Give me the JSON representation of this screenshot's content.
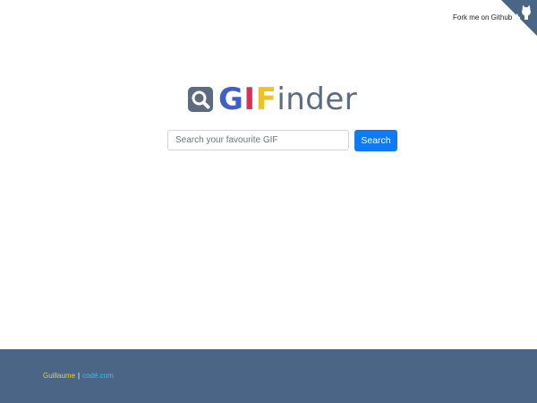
{
  "corner": {
    "fork_label": "Fork me on Github",
    "icon": "github-octocat-icon",
    "ribbon_color": "#4a6585"
  },
  "logo": {
    "icon": "magnifier-icon",
    "letters": [
      "G",
      "I",
      "F"
    ],
    "rest": "inder",
    "colors": {
      "G": "#3f5fc7",
      "I": "#d9325a",
      "F": "#f2c21e",
      "rest": "#5c6b80"
    }
  },
  "search": {
    "placeholder": "Search your favourite GIF",
    "value": "",
    "button_label": "Search",
    "button_color": "#0f7af5"
  },
  "footer": {
    "author": "Guillaume",
    "separator": "|",
    "site": "codé.com",
    "background": "#4a6585"
  }
}
